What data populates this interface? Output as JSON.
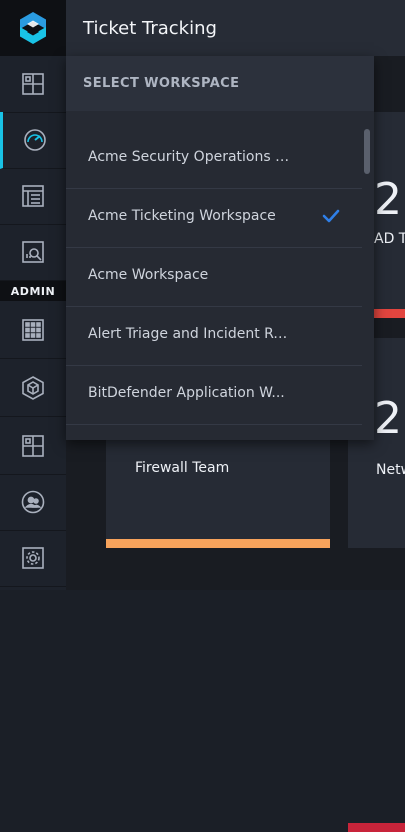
{
  "header": {
    "title": "Ticket Tracking"
  },
  "sidebar": {
    "admin_label": "ADMIN",
    "accent_color": "#19c3e6",
    "items": [
      {
        "name": "dashboards",
        "icon": "dashboard-grid-icon"
      },
      {
        "name": "analytics",
        "icon": "speedometer-icon",
        "active": true
      },
      {
        "name": "reports",
        "icon": "report-list-icon"
      },
      {
        "name": "investigate",
        "icon": "chart-search-icon"
      },
      {
        "name": "admin-apps",
        "icon": "app-grid-icon"
      },
      {
        "name": "admin-packages",
        "icon": "cube-icon"
      },
      {
        "name": "admin-workspaces",
        "icon": "workspace-grid-icon"
      },
      {
        "name": "admin-users",
        "icon": "users-circle-icon"
      },
      {
        "name": "admin-settings",
        "icon": "gear-icon"
      }
    ]
  },
  "dropdown": {
    "heading": "SELECT WORKSPACE",
    "items": [
      {
        "label": "Acme Security Operations (...",
        "selected": false
      },
      {
        "label": "Acme Ticketing Workspace",
        "selected": true
      },
      {
        "label": "Acme Workspace",
        "selected": false
      },
      {
        "label": "Alert Triage and Incident Re...",
        "selected": false
      },
      {
        "label": "BitDefender Application W...",
        "selected": false
      }
    ],
    "check_color": "#2f7fe8"
  },
  "cards": [
    {
      "big": "2",
      "caption": "AD T",
      "bar_color": "#e2453f"
    },
    {
      "big": "2",
      "caption": "Netw",
      "bar_color": "#c8243a"
    },
    {
      "caption": "Firewall Team",
      "bar_color": "#f7a35c"
    }
  ]
}
